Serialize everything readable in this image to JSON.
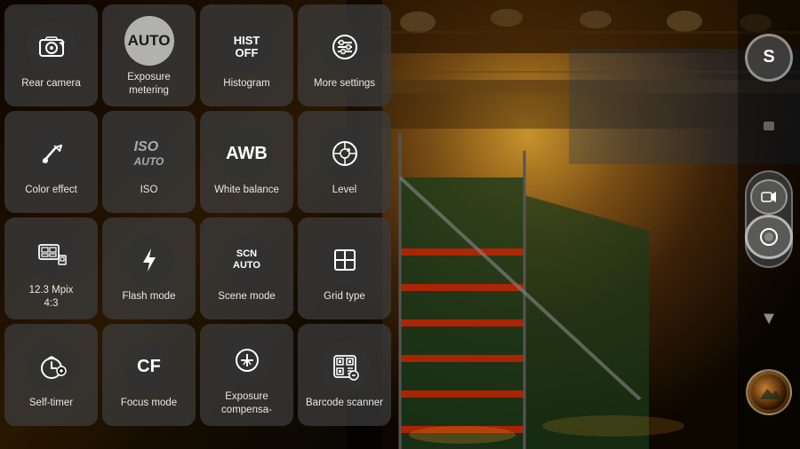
{
  "camera": {
    "background": "staircase interior scene",
    "settings": [
      {
        "id": "rear-camera",
        "label": "Rear camera",
        "icon_type": "camera-rotate",
        "row": 1,
        "col": 1
      },
      {
        "id": "exposure-metering",
        "label": "Exposure\nmetering",
        "icon_type": "auto-circle",
        "row": 1,
        "col": 2
      },
      {
        "id": "histogram",
        "label": "Histogram",
        "icon_type": "hist-off",
        "row": 1,
        "col": 3
      },
      {
        "id": "more-settings",
        "label": "More\nsettings",
        "icon_type": "sliders",
        "row": 1,
        "col": 4
      },
      {
        "id": "color-effect",
        "label": "Color effect",
        "icon_type": "wand",
        "row": 2,
        "col": 1
      },
      {
        "id": "iso",
        "label": "ISO",
        "icon_type": "iso-auto",
        "row": 2,
        "col": 2
      },
      {
        "id": "white-balance",
        "label": "White\nbalance",
        "icon_type": "awb",
        "row": 2,
        "col": 3
      },
      {
        "id": "level",
        "label": "Level",
        "icon_type": "level",
        "row": 2,
        "col": 4
      },
      {
        "id": "mpix",
        "label": "12.3 Mpix\n4:3",
        "icon_type": "resolution",
        "row": 3,
        "col": 1
      },
      {
        "id": "flash-mode",
        "label": "Flash mode",
        "icon_type": "flash",
        "row": 3,
        "col": 2
      },
      {
        "id": "scene-mode",
        "label": "Scene mode",
        "icon_type": "scn-auto",
        "row": 3,
        "col": 3
      },
      {
        "id": "grid-type",
        "label": "Grid type",
        "icon_type": "grid",
        "row": 3,
        "col": 4
      },
      {
        "id": "self-timer",
        "label": "Self-timer",
        "icon_type": "timer",
        "row": 4,
        "col": 1
      },
      {
        "id": "focus-mode",
        "label": "Focus mode",
        "icon_type": "cf",
        "row": 4,
        "col": 2
      },
      {
        "id": "exposure-comp",
        "label": "Exposure\ncompensa-",
        "icon_type": "exposure-comp",
        "row": 4,
        "col": 3
      },
      {
        "id": "barcode-scanner",
        "label": "Barcode\nscanner",
        "icon_type": "qr",
        "row": 4,
        "col": 4
      }
    ]
  },
  "right_panel": {
    "mode_dial_label": "S",
    "shutter_icon": "●",
    "gallery_label": "gallery"
  }
}
